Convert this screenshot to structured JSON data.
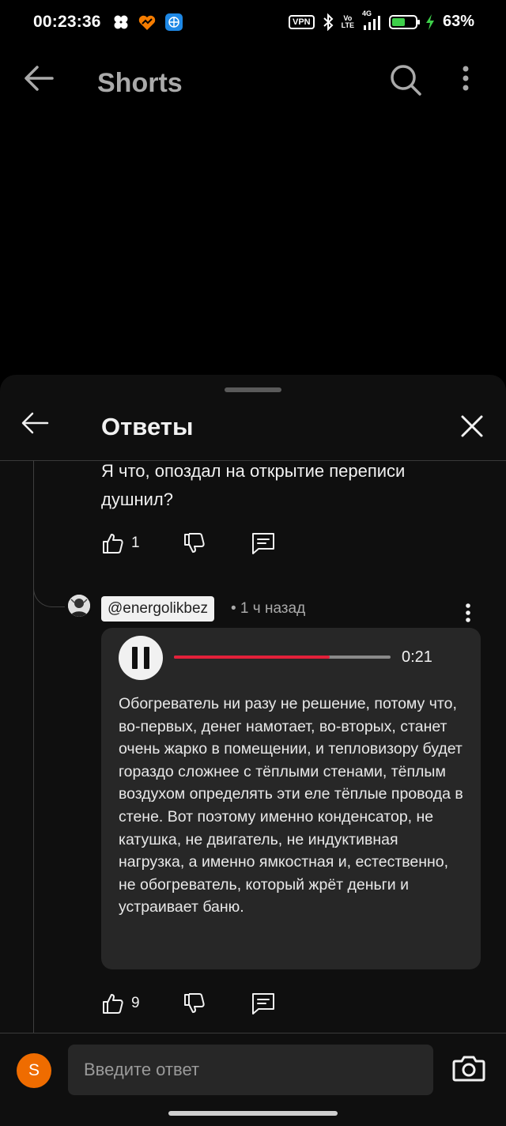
{
  "status_bar": {
    "time": "00:23:36",
    "vpn": "VPN",
    "volte_line1": "Vo",
    "volte_line2": "LTE",
    "network": "4G",
    "battery_percent": "63%",
    "battery_level": 0.63,
    "icons": [
      "dots-cluster-icon",
      "heart-app-icon",
      "globe-app-icon",
      "bluetooth-icon",
      "signal-icon",
      "battery-icon",
      "charging-bolt-icon"
    ]
  },
  "app_bar": {
    "title": "Shorts",
    "icons": [
      "back-arrow-icon",
      "search-icon",
      "more-vert-icon"
    ]
  },
  "sheet": {
    "title": "Ответы",
    "icons": [
      "back-arrow-icon",
      "close-icon"
    ]
  },
  "comments": [
    {
      "text": "Я что, опоздал на открытие переписи душнил?",
      "likes": "1"
    },
    {
      "author": "@energolikbez",
      "meta": "• 1 ч назад",
      "voice": {
        "duration": "0:21",
        "progress": 0.72,
        "transcript": "Обогреватель ни разу не решение, потому что, во-первых, денег намотает, во-вторых, станет очень жарко в помещении, и тепловизору будет гораздо сложнее с тёплыми стенами, тёплым воздухом определять эти еле тёплые провода в стене. Вот поэтому именно конденсатор, не катушка, не двигатель, не индуктивная нагрузка, а именно ямкостная и, естественно, не обогреватель, который жрёт деньги и устраивает баню."
      },
      "likes": "9"
    }
  ],
  "composer": {
    "avatar_letter": "S",
    "placeholder": "Введите ответ"
  },
  "colors": {
    "background": "#000000",
    "sheet": "#0f0f0f",
    "card": "#272727",
    "progress_played": "#e3203a",
    "avatar": "#ef6c00",
    "battery": "#3ecf4a"
  }
}
